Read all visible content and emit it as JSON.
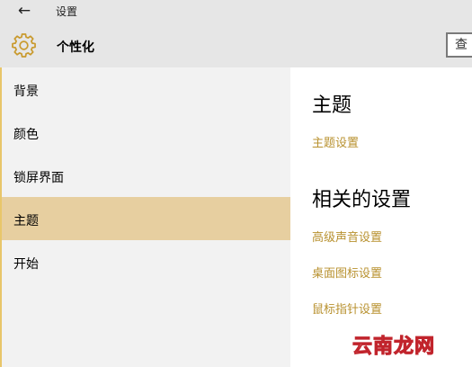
{
  "window": {
    "title": "设置"
  },
  "header": {
    "title": "个性化",
    "search_placeholder": "查"
  },
  "sidebar": {
    "items": [
      {
        "label": "背景",
        "selected": false
      },
      {
        "label": "颜色",
        "selected": false
      },
      {
        "label": "锁屏界面",
        "selected": false
      },
      {
        "label": "主题",
        "selected": true
      },
      {
        "label": "开始",
        "selected": false
      }
    ]
  },
  "main": {
    "theme_section": {
      "title": "主题",
      "link": "主题设置"
    },
    "related_section": {
      "title": "相关的设置",
      "links": [
        "高级声音设置",
        "桌面图标设置",
        "鼠标指针设置"
      ]
    }
  },
  "watermark": "云南龙网",
  "colors": {
    "accent": "#b8912f",
    "selected_bg": "#e7cfa0",
    "header_bg": "#e6e6e6",
    "sidebar_bg": "#f2f2f2",
    "watermark": "#c1242c"
  }
}
